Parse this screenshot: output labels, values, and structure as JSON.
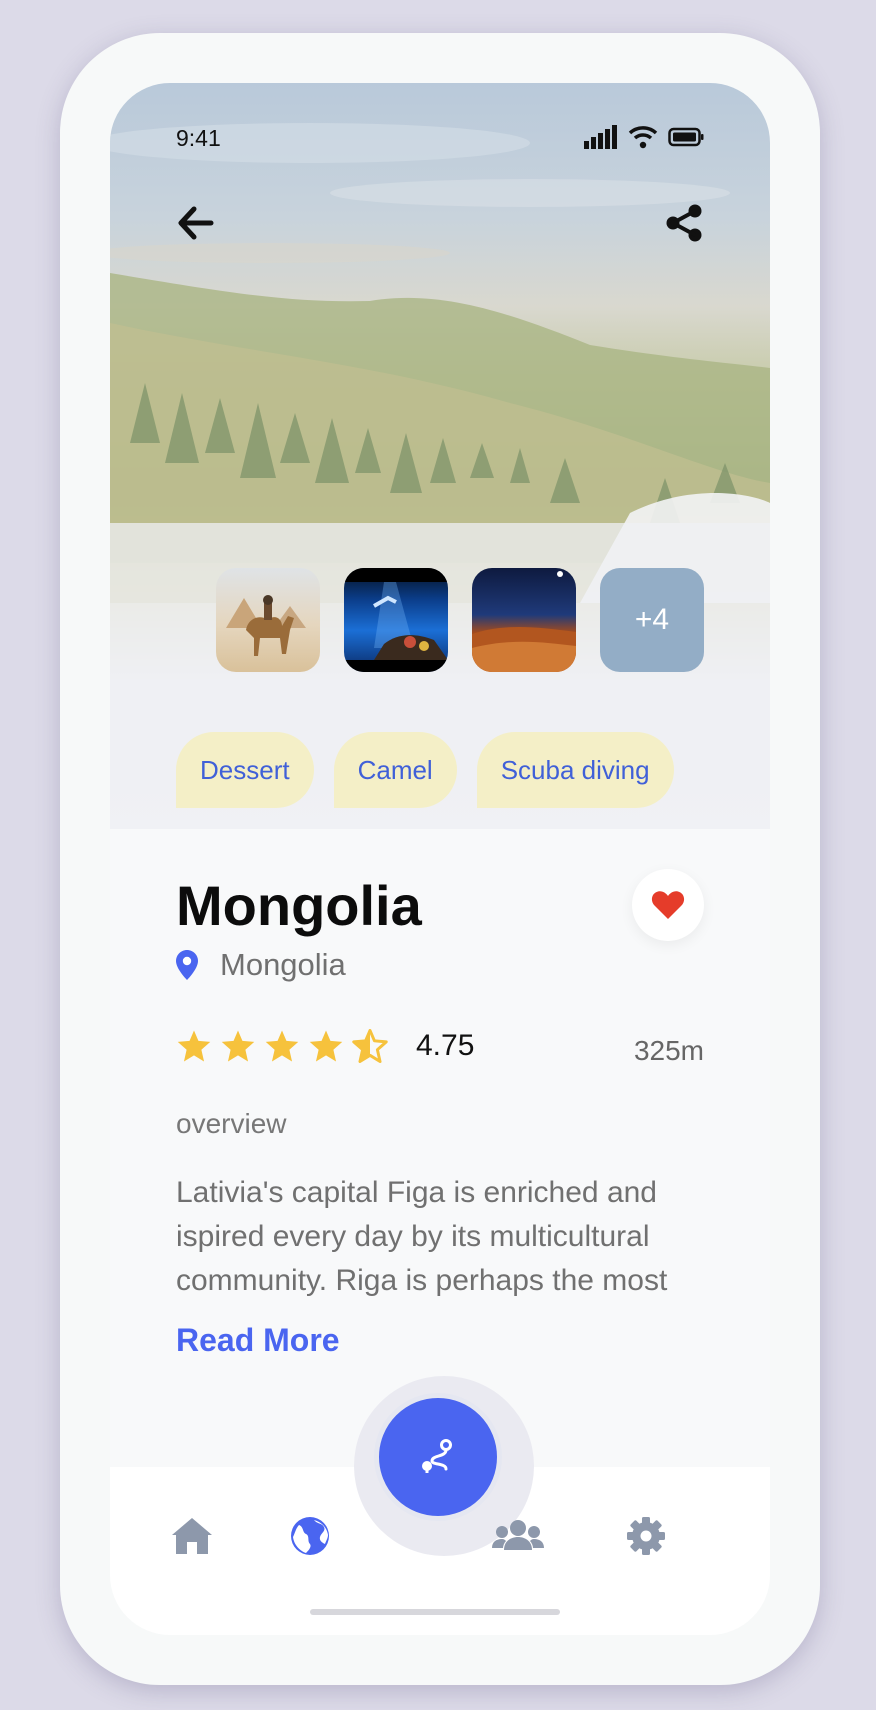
{
  "status": {
    "time": "9:41"
  },
  "gallery": {
    "more_label": "+4"
  },
  "tags": [
    "Dessert",
    "Camel",
    "Scuba diving"
  ],
  "place": {
    "title": "Mongolia",
    "location": "Mongolia",
    "rating": "4.75",
    "rating_stars": 4.5,
    "distance": "325m",
    "overview_label": "overview",
    "description": "Lativia's capital Figa is enriched and ispired every day by its multicultural community. Riga is perhaps the most",
    "read_more": "Read More"
  },
  "colors": {
    "accent": "#4a65f0",
    "star": "#f6c23c",
    "heart": "#e53c2a",
    "tag_bg": "#f4efc7"
  },
  "icons": {
    "back": "arrow-left-icon",
    "share": "share-icon",
    "location": "map-pin-icon",
    "favorite": "heart-icon",
    "route": "route-icon",
    "home": "home-icon",
    "explore": "globe-icon",
    "community": "users-icon",
    "settings": "gear-icon"
  }
}
